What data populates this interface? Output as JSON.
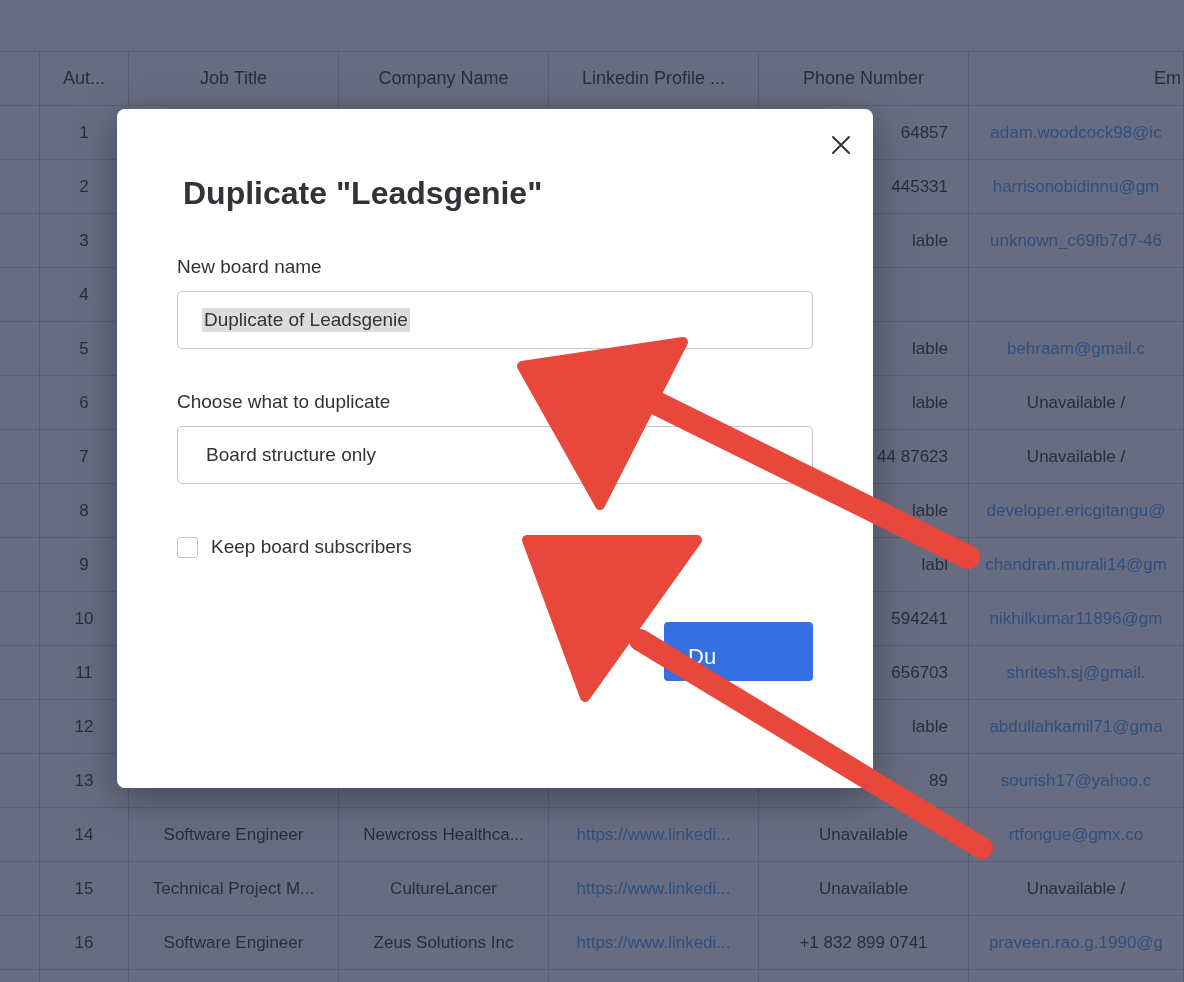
{
  "table": {
    "columns": [
      "Aut...",
      "Job Title",
      "Company Name",
      "Linkedin Profile ...",
      "Phone Number",
      "Em"
    ],
    "rows": [
      {
        "number": "1",
        "phone": "64857",
        "email": "adam.woodcock98@ic",
        "email_link": true
      },
      {
        "number": "2",
        "phone": "445331",
        "email": "harrisonobidinnu@gm",
        "email_link": true
      },
      {
        "number": "3",
        "phone": "lable",
        "email": "unknown_c69fb7d7-46",
        "email_link": true
      },
      {
        "number": "4"
      },
      {
        "number": "5",
        "phone": "lable",
        "email": "behraam@gmail.c",
        "email_link": true
      },
      {
        "number": "6",
        "phone": "lable",
        "email": "Unavailable /",
        "email_link": false
      },
      {
        "number": "7",
        "phone": "44 87623",
        "email": "Unavailable /",
        "email_link": false
      },
      {
        "number": "8",
        "phone": "lable",
        "email": "developer.ericgitangu@",
        "email_link": true
      },
      {
        "number": "9",
        "phone": "labl",
        "email": "chandran.murali14@gm",
        "email_link": true
      },
      {
        "number": "10",
        "phone": "594241",
        "email": "nikhilkumar11896@gm",
        "email_link": true
      },
      {
        "number": "11",
        "phone": "656703",
        "email": "shritesh.sj@gmail.",
        "email_link": true
      },
      {
        "number": "12",
        "phone": "lable",
        "email": "abdullahkamil71@gma",
        "email_link": true
      },
      {
        "number": "13",
        "phone": "89",
        "email": "sourish17@yahoo.c",
        "email_link": true
      },
      {
        "number": "14",
        "job_title": "Software Engineer",
        "company": "Newcross Healthca...",
        "linkedin": "https://www.linkedi...",
        "phone": "Unavailable",
        "email": "rtfongue@gmx.co",
        "email_link": true
      },
      {
        "number": "15",
        "job_title": "Technical Project M...",
        "company": "CultureLancer",
        "linkedin": "https://www.linkedi...",
        "phone": "Unavailable",
        "email": "Unavailable /",
        "email_link": false
      },
      {
        "number": "16",
        "job_title": "Software Engineer",
        "company": "Zeus Solutions Inc",
        "linkedin": "https://www.linkedi...",
        "phone": "+1 832 899 0741",
        "email": "praveen.rao.g.1990@g",
        "email_link": true
      }
    ]
  },
  "dialog": {
    "title": "Duplicate \"Leadsgenie\"",
    "name_label": "New board name",
    "name_value": "Duplicate of Leadsgenie",
    "name_value_selected": true,
    "choice_label": "Choose what to duplicate",
    "choice_value": "Board structure only",
    "checkbox": {
      "label": "Keep board subscribers",
      "checked": false
    },
    "button": "Du"
  }
}
